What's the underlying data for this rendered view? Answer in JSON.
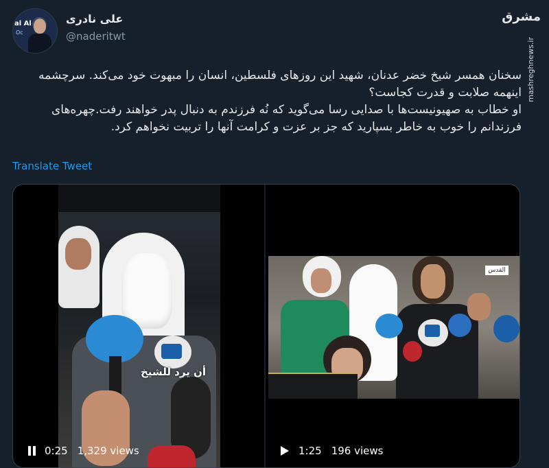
{
  "tweet": {
    "display_name": "علی نادری",
    "handle": "@naderitwt",
    "avatar_text": "al Al",
    "avatar_text2": "Oc",
    "paragraphs": [
      "سخنان همسر شیخ خضر عدنان، شهید این روزهای فلسطین، انسان را مبهوت خود می‌کند. سرچشمه اینهمه صلابت و قدرت کجاست؟",
      "او خطاب به صهیونیست‌ها با صدایی رسا می‌گوید که نُه فرزندم به دنبال پدر خواهند رفت.چهره‌های فرزندانم را خوب به خاطر بسپارید که جز بر عزت و کرامت آنها را تربیت نخواهم کرد."
    ],
    "translate_label": "Translate Tweet"
  },
  "watermark": {
    "logo": "مشرق",
    "url": "mashreghnews.ir"
  },
  "videos": [
    {
      "caption": "أن يرد للشيخ",
      "time": "0:25",
      "views": "1,329 views",
      "state": "playing"
    },
    {
      "banner_text": "",
      "channel_logo": "القدس",
      "time": "1:25",
      "views": "196 views",
      "state": "paused"
    }
  ]
}
